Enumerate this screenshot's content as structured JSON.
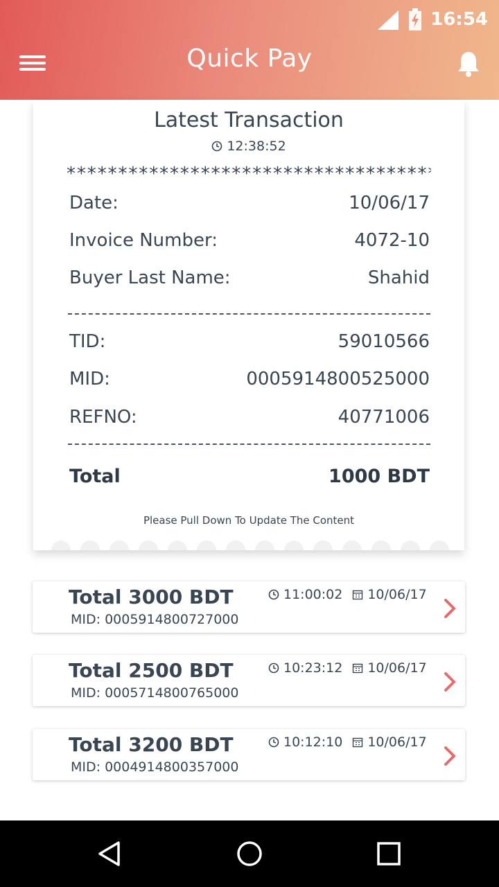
{
  "status_bar": {
    "time": "16:54"
  },
  "header": {
    "title": "Quick Pay"
  },
  "receipt": {
    "title": "Latest Transaction",
    "time": "12:38:52",
    "stars": "*****************************************",
    "date_label": "Date:",
    "date_value": "10/06/17",
    "invoice_label": "Invoice Number:",
    "invoice_value": "4072-10",
    "buyer_label": "Buyer Last Name:",
    "buyer_value": "Shahid",
    "tid_label": "TID:",
    "tid_value": "59010566",
    "mid_label": "MID:",
    "mid_value": "0005914800525000",
    "refno_label": "REFNO:",
    "refno_value": "40771006",
    "total_label": "Total",
    "total_value": "1000 BDT",
    "pull_hint": "Please Pull Down To Update The Content"
  },
  "history": [
    {
      "total": "Total 3000 BDT",
      "mid": "MID: 0005914800727000",
      "time": "11:00:02",
      "date": "10/06/17"
    },
    {
      "total": "Total 2500 BDT",
      "mid": "MID: 0005714800765000",
      "time": "10:23:12",
      "date": "10/06/17"
    },
    {
      "total": "Total 3200 BDT",
      "mid": "MID: 0004914800357000",
      "time": "10:12:10",
      "date": "10/06/17"
    }
  ],
  "colors": {
    "header_start": "#e25a58",
    "header_end": "#f0b88c",
    "chevron": "#e46c6c",
    "text": "#3a4552"
  }
}
